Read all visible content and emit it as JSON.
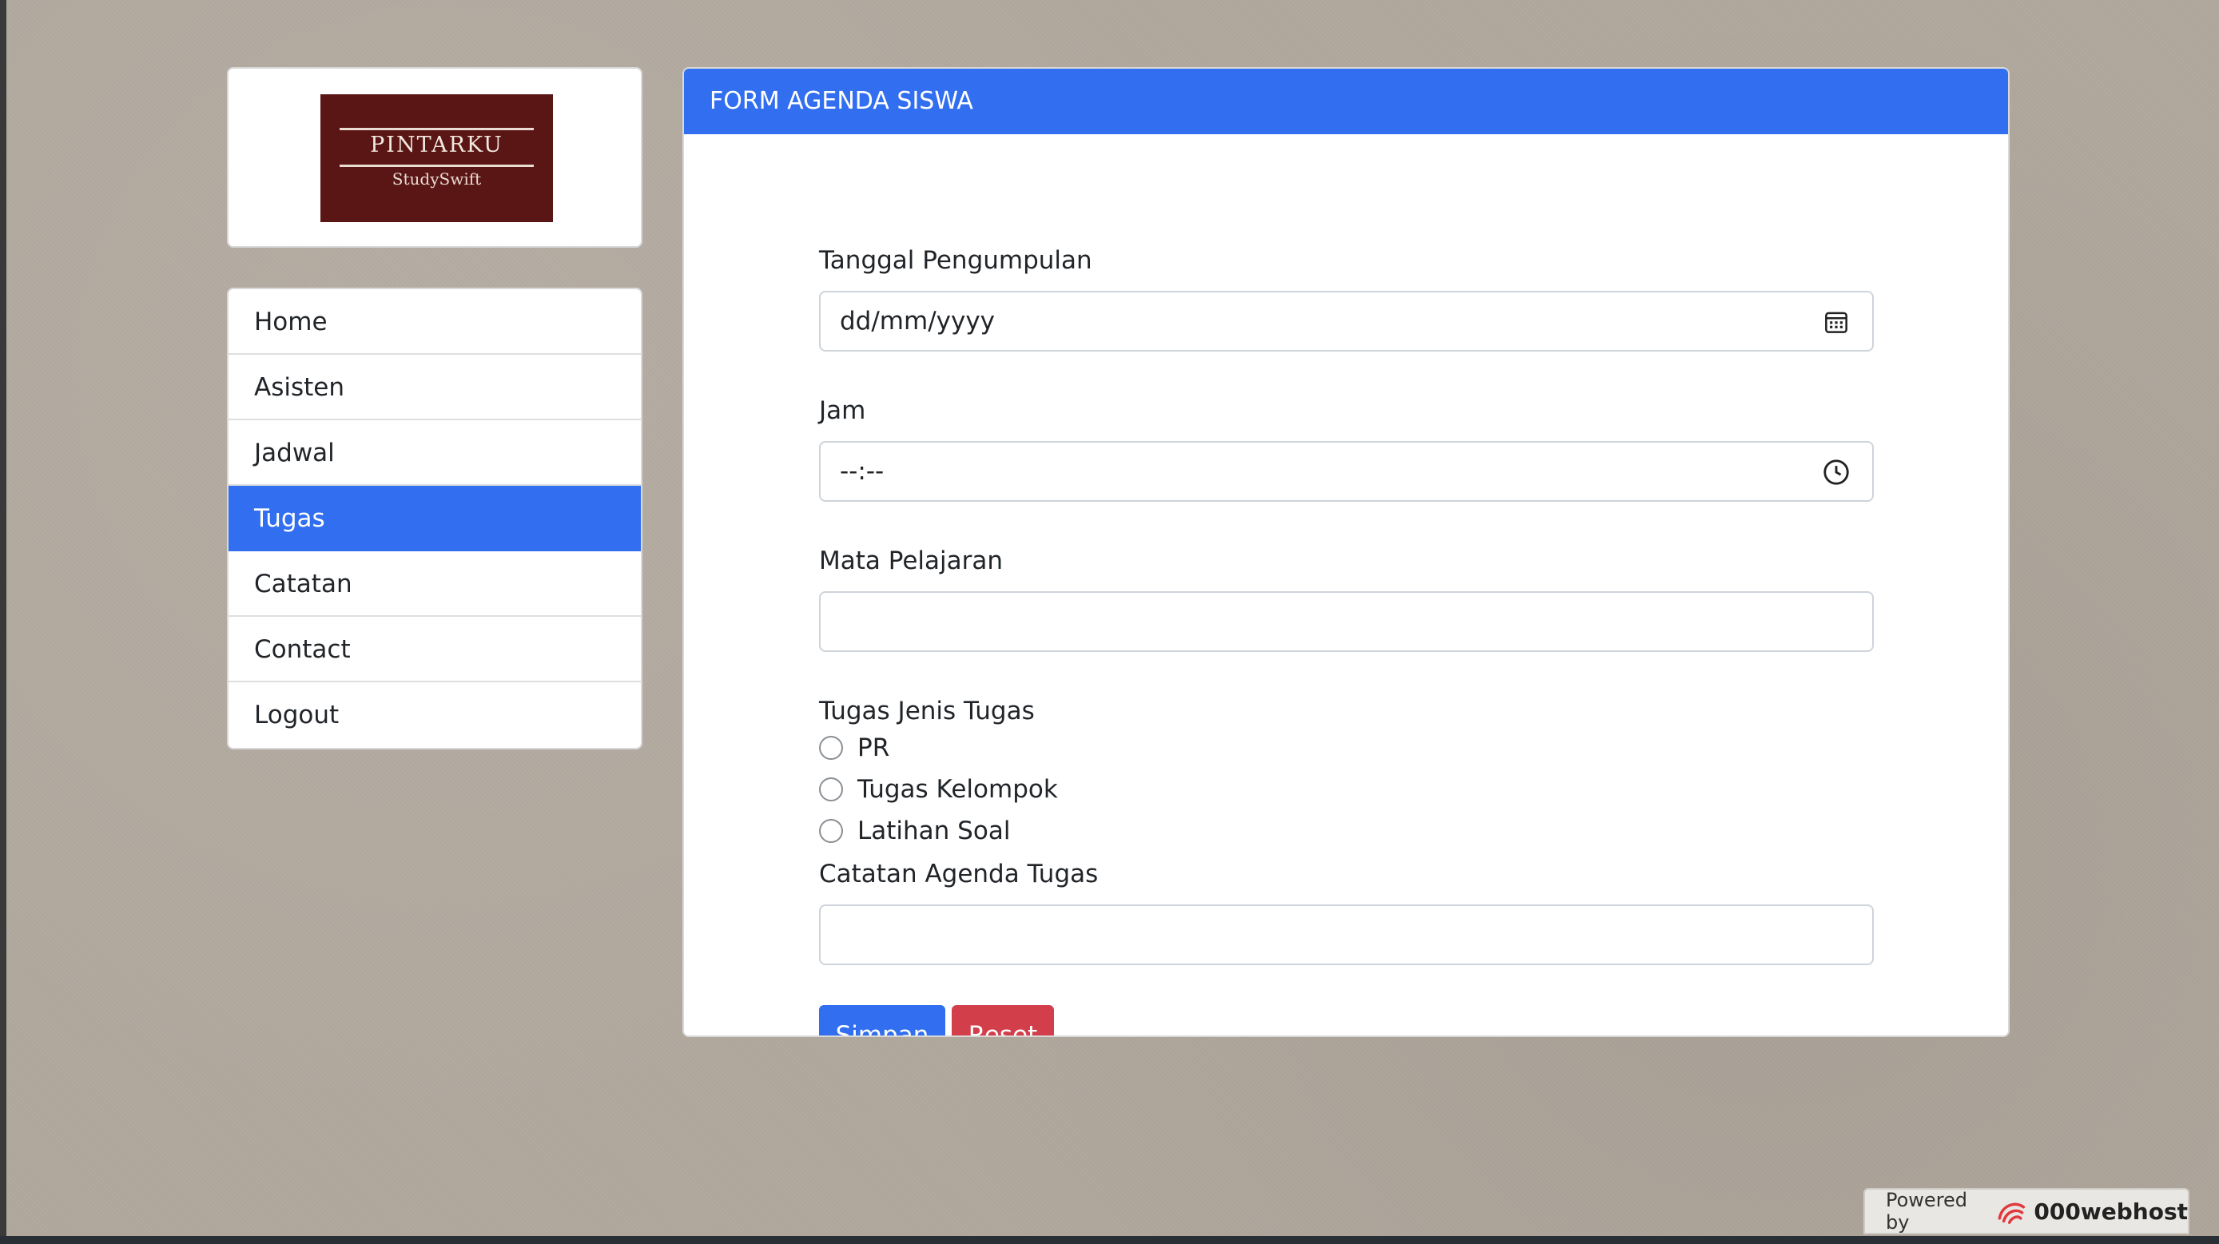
{
  "logo": {
    "title": "PINTARKU",
    "subtitle": "StudySwift"
  },
  "nav": {
    "items": [
      {
        "label": "Home"
      },
      {
        "label": "Asisten"
      },
      {
        "label": "Jadwal"
      },
      {
        "label": "Tugas",
        "active": true
      },
      {
        "label": "Catatan"
      },
      {
        "label": "Contact"
      },
      {
        "label": "Logout"
      }
    ]
  },
  "form": {
    "header": "FORM AGENDA SISWA",
    "date_label": "Tanggal Pengumpulan",
    "date_placeholder": "dd/mm/yyyy",
    "time_label": "Jam",
    "time_placeholder": "--:--",
    "subject_label": "Mata Pelajaran",
    "subject_value": "",
    "task_type_label": "Tugas Jenis Tugas",
    "task_types": [
      "PR",
      "Tugas Kelompok",
      "Latihan Soal"
    ],
    "notes_label": "Catatan Agenda Tugas",
    "notes_value": "",
    "save_label": "Simpan",
    "reset_label": "Reset"
  },
  "footer": {
    "powered_by": "Powered by",
    "brand": "000webhost"
  },
  "colors": {
    "primary": "#316ef0",
    "danger": "#d23f4b",
    "logo_bg": "#5a1614"
  }
}
